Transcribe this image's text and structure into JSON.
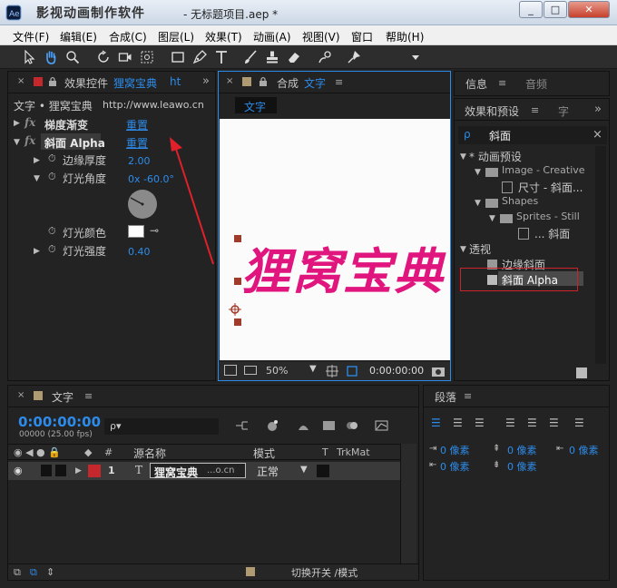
{
  "window": {
    "watermark": "影视动画制作软件",
    "title": "- 无标题项目.aep *",
    "btn_min": "_",
    "btn_max": "□",
    "btn_close": "✕"
  },
  "menu": [
    "文件(F)",
    "编辑(E)",
    "合成(C)",
    "图层(L)",
    "效果(T)",
    "动画(A)",
    "视图(V)",
    "窗口",
    "帮助(H)"
  ],
  "effect_controls": {
    "tab_prefix": "效果控件",
    "tab_layer": "狸窝宝典",
    "tab_more": "ht",
    "breadcrumb": "文字 • 狸窝宝典",
    "url": "http://www.leawo.cn",
    "fx_symbol": "fx",
    "effects": [
      {
        "name": "梯度渐变",
        "reset": "重置"
      },
      {
        "name": "斜面 Alpha",
        "reset": "重置"
      }
    ],
    "props": {
      "edge_thickness_label": "边缘厚度",
      "edge_thickness_value": "2.00",
      "light_angle_label": "灯光角度",
      "light_angle_value": "0x -60.0°",
      "light_color_label": "灯光颜色",
      "light_intensity_label": "灯光强度",
      "light_intensity_value": "0.40"
    }
  },
  "composition": {
    "tab_label": "合成",
    "tab_name": "文字",
    "subtab": "文字",
    "canvas_text": "狸窝宝典",
    "text_color": "#e0167e",
    "zoom": "50%",
    "timecode": "0:00:00:00"
  },
  "info_panel": {
    "tab_info": "信息",
    "tab_audio": "音频"
  },
  "effects_presets": {
    "tab_label": "效果和预设",
    "tab_more": "字",
    "search_value": "斜面",
    "tree": {
      "anim_presets": "* 动画预设",
      "image_creative": "Image - Creative",
      "size_bevel": "尺寸 - 斜面...",
      "shapes": "Shapes",
      "sprites_still": "Sprites - Still",
      "dots_bevel": "... 斜面",
      "perspective": "透视",
      "bevel_edges": "边缘斜面",
      "bevel_alpha": "斜面 Alpha"
    },
    "highlight_color": "#d0202a"
  },
  "timeline": {
    "tab_label": "文字",
    "timecode": "0:00:00:00",
    "fps": "00000 (25.00 fps)",
    "search_placeholder": "ρ▾",
    "col_num": "#",
    "col_source": "源名称",
    "col_mode": "模式",
    "col_t": "T",
    "col_trkmat": "TrkMat",
    "layer_index": "1",
    "layer_type_icon": "T",
    "layer_name": "狸窝宝典",
    "layer_name_tail": "...o.cn",
    "layer_mode": "正常",
    "footer_toggle": "切换开关 /模式"
  },
  "paragraph": {
    "tab_label": "段落",
    "values": [
      "0 像素",
      "0 像素",
      "0 像素",
      "0 像素",
      "0 像素"
    ]
  }
}
